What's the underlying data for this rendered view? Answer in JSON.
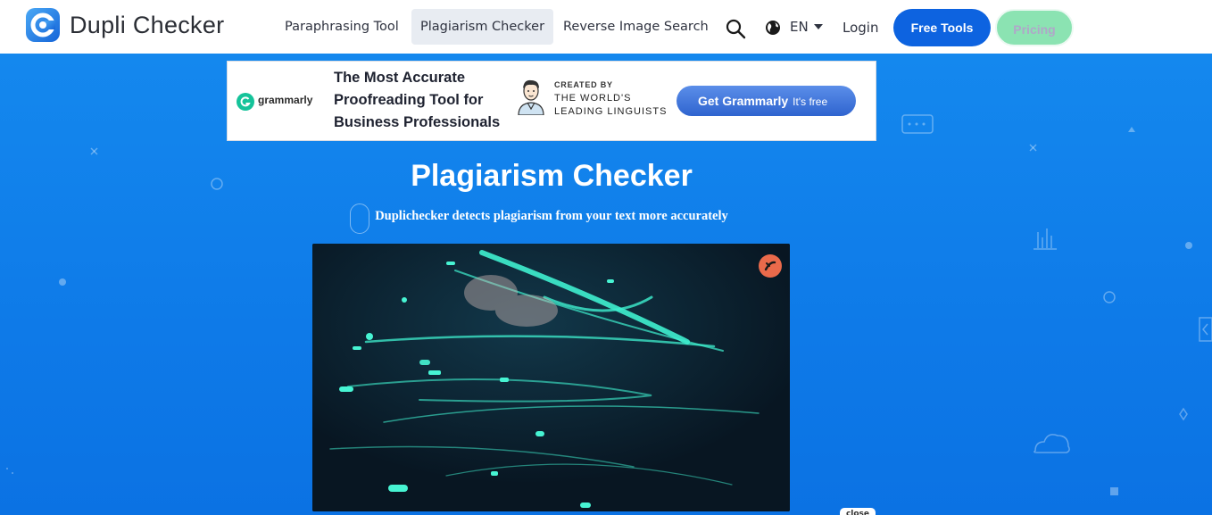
{
  "brand": {
    "name": "Dupli Checker"
  },
  "nav": {
    "links": [
      {
        "label": "Paraphrasing Tool"
      },
      {
        "label": "Plagiarism Checker"
      },
      {
        "label": "Reverse Image Search"
      }
    ],
    "language": "EN",
    "login": "Login",
    "free_tools": "Free Tools",
    "pricing": "Pricing"
  },
  "ad": {
    "brand": "grammarly",
    "headline": "The Most Accurate Proofreading Tool for Business Professionals",
    "created_by": "CREATED BY",
    "created_by_line2": "THE WORLD'S LEADING LINGUISTS",
    "cta": "Get Grammarly",
    "cta_sub": "It's free"
  },
  "hero": {
    "title": "Plagiarism Checker",
    "subtitle": "Duplichecker detects plagiarism from your text more accurately"
  },
  "video": {
    "close_label": "close"
  },
  "colors": {
    "primary": "#0d63e0",
    "hero_bg": "#1488ee",
    "pricing_bg": "#8be3b2",
    "grammarly_green": "#15c39a"
  },
  "icons": [
    "logo-icon",
    "search-icon",
    "globe-icon",
    "chevron-down-icon",
    "grammarly-logo-icon",
    "linguist-avatar-icon",
    "video-brand-icon"
  ]
}
